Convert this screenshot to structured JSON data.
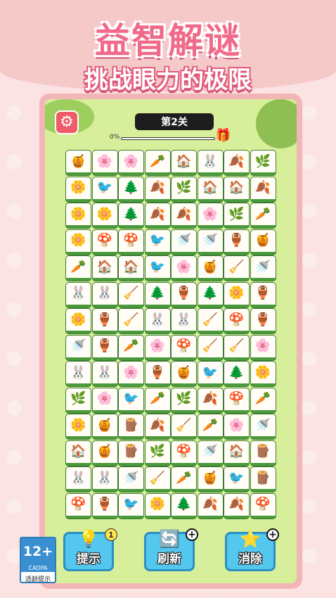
{
  "colors": {
    "accent": "#f06a8a",
    "tile_border": "#4a9b3c",
    "button": "#54c7ee"
  },
  "headline": {
    "title": "益智解谜",
    "subtitle": "挑战眼力的极限"
  },
  "game": {
    "level_label": "第2关",
    "progress_text": "0%",
    "progress_value": 0,
    "settings_icon": "gear-icon",
    "gift_icon": "gift-icon"
  },
  "board": {
    "rows": [
      [
        "🍯",
        "🌸",
        "🌸",
        "🥕",
        "🏠",
        "🐰",
        "🍂",
        "🌿"
      ],
      [
        "🌼",
        "🐦",
        "🌲",
        "🍂",
        "🌿",
        "🏠",
        "🏠",
        "🍂"
      ],
      [
        "🌼",
        "🌼",
        "🌲",
        "🍂",
        "🍂",
        "🌸",
        "🌿",
        "🥕"
      ],
      [
        "🌼",
        "🍄",
        "🍄",
        "🐦",
        "🚿",
        "🚿",
        "🏺",
        "🍯"
      ],
      [
        "🥕",
        "🏠",
        "🏠",
        "🐦",
        "🌸",
        "🍯",
        "🧹",
        "🚿"
      ],
      [
        "🐰",
        "🐰",
        "🧹",
        "🌲",
        "🏺",
        "🌲",
        "🌼",
        "🏺"
      ],
      [
        "🌼",
        "🏺",
        "🧹",
        "🐰",
        "🐰",
        "🧹",
        "🍄",
        "🏺"
      ],
      [
        "🚿",
        "🏺",
        "🥕",
        "🌸",
        "🍄",
        "🧹",
        "🧹",
        "🌸"
      ],
      [
        "🐰",
        "🐰",
        "🌸",
        "🏺",
        "🍯",
        "🐦",
        "🌲",
        "🌼"
      ],
      [
        "🌿",
        "🌸",
        "🐦",
        "🥕",
        "🌿",
        "🍂",
        "🍄",
        "🥕"
      ],
      [
        "🌼",
        "🍯",
        "🪵",
        "🍂",
        "🧹",
        "🥕",
        "🌸",
        "🚿"
      ],
      [
        "🏠",
        "🍯",
        "🪵",
        "🌿",
        "🍄",
        "🚿",
        "🏠",
        "🪵"
      ],
      [
        "🐰",
        "🐰",
        "🚿",
        "🧹",
        "🥕",
        "🍯",
        "🐦",
        "🪵"
      ],
      [
        "🍄",
        "🏺",
        "🐦",
        "🌼",
        "🌲",
        "🍂",
        "🍂",
        "🍄"
      ]
    ]
  },
  "actions": {
    "hint": {
      "label": "提示",
      "icon": "lightbulb-icon",
      "count": "1"
    },
    "refresh": {
      "label": "刷新",
      "icon": "refresh-icon",
      "badge": "+"
    },
    "remove": {
      "label": "消除",
      "icon": "star-icon",
      "badge": "+"
    }
  },
  "age_rating": {
    "age": "12+",
    "org": "CADPA",
    "note": "适龄提示"
  }
}
